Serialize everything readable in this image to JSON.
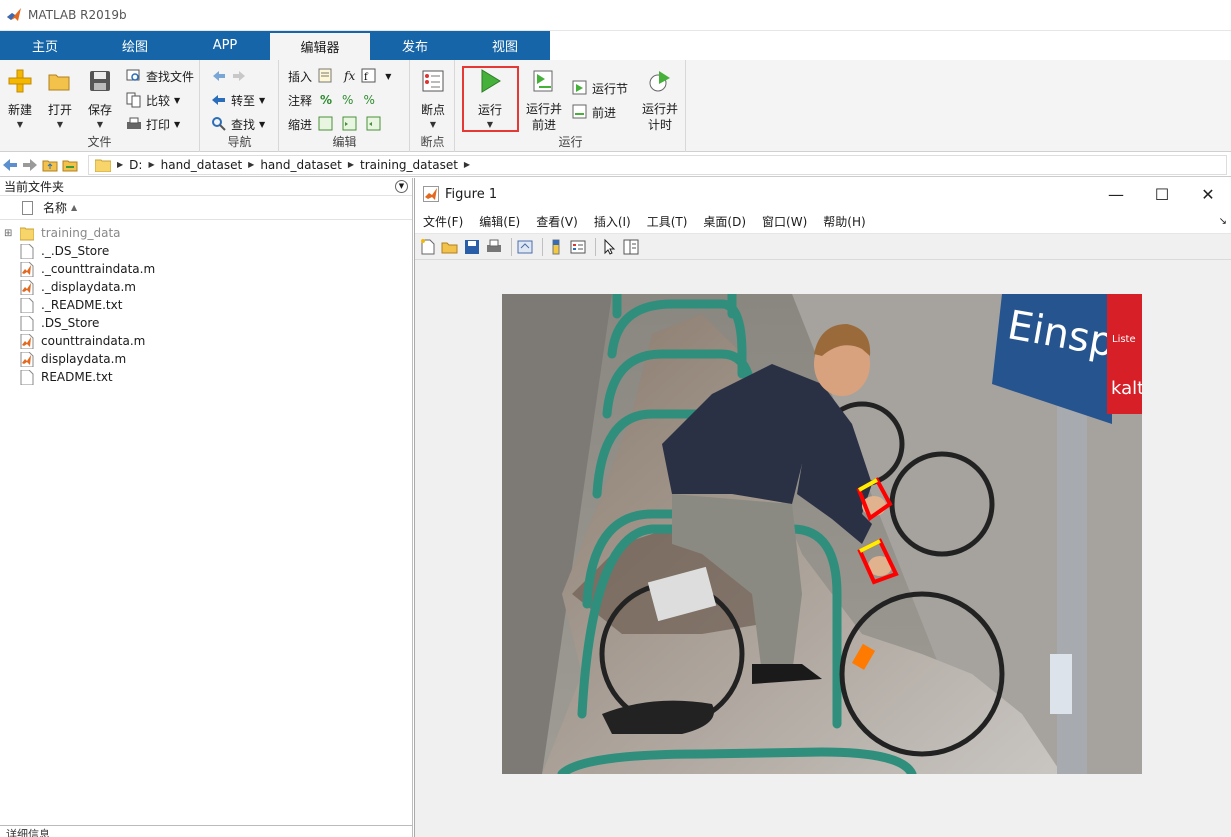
{
  "app": {
    "title": "MATLAB R2019b"
  },
  "tabs": [
    {
      "label": "主页"
    },
    {
      "label": "绘图"
    },
    {
      "label": "APP"
    },
    {
      "label": "编辑器",
      "active": true
    },
    {
      "label": "发布"
    },
    {
      "label": "视图"
    }
  ],
  "ribbon": {
    "file": {
      "group_label": "文件",
      "new_label": "新建",
      "open_label": "打开",
      "save_label": "保存",
      "find_files_label": "查找文件",
      "compare_label": "比较",
      "print_label": "打印"
    },
    "nav": {
      "group_label": "导航",
      "goto_label": "转至",
      "find_label": "查找"
    },
    "edit": {
      "group_label": "编辑",
      "insert_label": "插入",
      "comment_label": "注释",
      "indent_label": "缩进",
      "fx_label": "fx"
    },
    "breakpoints": {
      "group_label": "断点",
      "bp_label": "断点"
    },
    "run": {
      "group_label": "运行",
      "run_label": "运行",
      "run_advance_label": "运行并\n前进",
      "run_section_label": "运行节",
      "advance_label": "前进",
      "run_time_label": "运行并\n计时"
    }
  },
  "address": {
    "segments": [
      "D:",
      "hand_dataset",
      "hand_dataset",
      "training_dataset"
    ]
  },
  "filepanel": {
    "title": "当前文件夹",
    "column_name": "名称",
    "files": [
      {
        "name": "training_data",
        "type": "folder"
      },
      {
        "name": "._.DS_Store",
        "type": "file"
      },
      {
        "name": "._counttraindata.m",
        "type": "mfile"
      },
      {
        "name": "._displaydata.m",
        "type": "mfile"
      },
      {
        "name": "._README.txt",
        "type": "file"
      },
      {
        "name": ".DS_Store",
        "type": "file"
      },
      {
        "name": "counttraindata.m",
        "type": "mfile"
      },
      {
        "name": "displaydata.m",
        "type": "mfile"
      },
      {
        "name": "README.txt",
        "type": "file"
      }
    ],
    "details_label": "详细信息"
  },
  "figure": {
    "title": "Figure 1",
    "menu": [
      "文件(F)",
      "编辑(E)",
      "查看(V)",
      "插入(I)",
      "工具(T)",
      "桌面(D)",
      "窗口(W)",
      "帮助(H)"
    ],
    "sign_text": "Einspurige",
    "poster_text_1": "Liste",
    "poster_text_2": "kalt"
  },
  "colors": {
    "tab_bar": "#0e4a7c",
    "tab_active": "#f4f4f4",
    "highlight": "#e53935",
    "hand_box": "#ff0000",
    "wrist_mark": "#ffee00"
  }
}
